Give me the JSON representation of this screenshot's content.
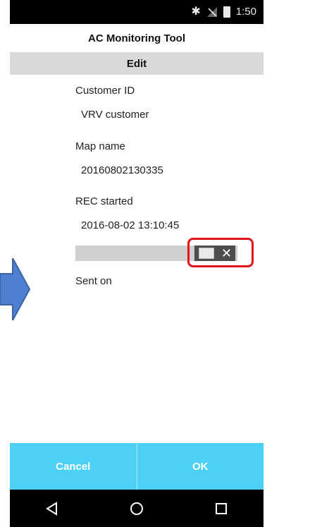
{
  "status": {
    "time": "1:50",
    "icons": [
      "bluetooth-icon",
      "no-signal-icon",
      "battery-icon"
    ]
  },
  "app": {
    "title": "AC Monitoring Tool",
    "subtitle": "Edit"
  },
  "fields": {
    "customer_id_label": "Customer ID",
    "customer_id_value": "VRV customer",
    "map_name_label": "Map name",
    "map_name_value": "20160802130335",
    "rec_started_label": "REC started",
    "rec_started_value": "2016-08-02 13:10:45",
    "sent_on_label": "Sent on"
  },
  "toggle": {
    "state": "off",
    "x_glyph": "✕"
  },
  "buttons": {
    "cancel": "Cancel",
    "ok": "OK"
  },
  "colors": {
    "accent": "#4cd0f5",
    "highlight": "#e1161d",
    "arrow": "#4f7fd0"
  }
}
